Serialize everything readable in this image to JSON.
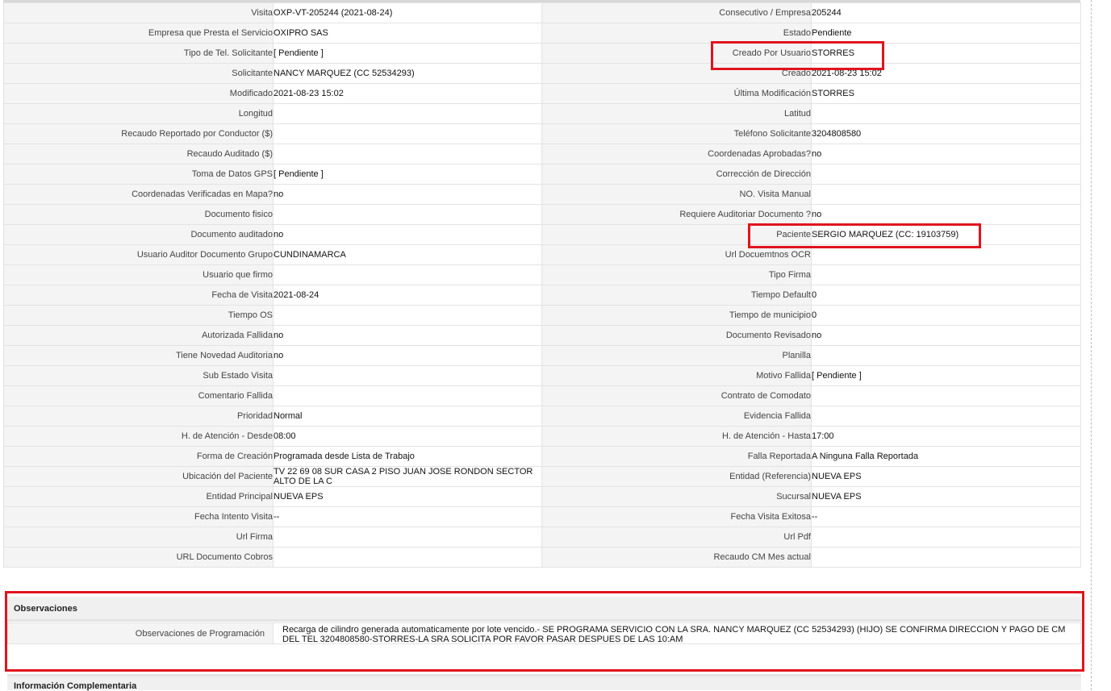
{
  "rows": [
    {
      "l1": "Visita",
      "v1": "OXP-VT-205244 (2021-08-24)",
      "l2": "Consecutivo / Empresa",
      "v2": "205244"
    },
    {
      "l1": "Empresa que Presta el Servicio",
      "v1": "OXIPRO SAS",
      "l2": "Estado",
      "v2": "Pendiente"
    },
    {
      "l1": "Tipo de Tel. Solicitante",
      "v1": "[ Pendiente ]",
      "l2": "Creado Por Usuario",
      "v2": "STORRES"
    },
    {
      "l1": "Solicitante",
      "v1": "NANCY MARQUEZ (CC 52534293)",
      "l2": "Creado",
      "v2": "2021-08-23 15:02"
    },
    {
      "l1": "Modificado",
      "v1": "2021-08-23 15:02",
      "l2": "Última Modificación",
      "v2": " STORRES"
    },
    {
      "l1": "Longitud",
      "v1": "",
      "l2": "Latitud",
      "v2": ""
    },
    {
      "l1": "Recaudo Reportado por Conductor ($)",
      "v1": "",
      "l2": "Teléfono Solicitante",
      "v2": "3204808580"
    },
    {
      "l1": "Recaudo Auditado ($)",
      "v1": "",
      "l2": "Coordenadas Aprobadas?",
      "v2": " no"
    },
    {
      "l1": "Toma de Datos GPS",
      "v1": "[ Pendiente ]",
      "l2": "Corrección de Dirección",
      "v2": ""
    },
    {
      "l1": "Coordenadas Verificadas en Mapa?",
      "v1": " no",
      "l2": "NO. Visita Manual",
      "v2": ""
    },
    {
      "l1": "Documento fisico",
      "v1": "",
      "l2": "Requiere Auditoriar Documento ?",
      "v2": " no"
    },
    {
      "l1": "Documento auditado",
      "v1": "no",
      "l2": "Paciente",
      "v2": "SERGIO MARQUEZ (CC: 19103759)"
    },
    {
      "l1": "Usuario Auditor Documento Grupo",
      "v1": "CUNDINAMARCA",
      "l2": "Url Docuemtnos OCR",
      "v2": ""
    },
    {
      "l1": "Usuario que firmo",
      "v1": "",
      "l2": "Tipo Firma",
      "v2": ""
    },
    {
      "l1": "Fecha de Visita",
      "v1": " 2021-08-24",
      "l2": "Tiempo Default",
      "v2": "0"
    },
    {
      "l1": "Tiempo OS",
      "v1": "",
      "l2": "Tiempo de municipio",
      "v2": "0"
    },
    {
      "l1": "Autorizada Fallida",
      "v1": "no",
      "l2": "Documento Revisado",
      "v2": " no"
    },
    {
      "l1": "Tiene Novedad Auditoria",
      "v1": "no",
      "l2": "Planilla",
      "v2": ""
    },
    {
      "l1": "Sub Estado Visita",
      "v1": "",
      "l2": "Motivo Fallida",
      "v2": "[ Pendiente ]"
    },
    {
      "l1": "Comentario Fallida",
      "v1": "",
      "l2": "Contrato de Comodato",
      "v2": ""
    },
    {
      "l1": "Prioridad",
      "v1": "Normal",
      "l2": "Evidencia Fallida",
      "v2": ""
    },
    {
      "l1": "H. de Atención - Desde",
      "v1": "08:00",
      "l2": "H. de Atención - Hasta",
      "v2": "17:00"
    },
    {
      "l1": "Forma de Creación",
      "v1": "Programada desde Lista de Trabajo",
      "l2": "Falla Reportada",
      "v2": "A Ninguna Falla Reportada"
    },
    {
      "l1": "Ubicación del Paciente",
      "v1": "TV 22 69 08 SUR CASA 2 PISO JUAN JOSE RONDON SECTOR ALTO DE LA C",
      "l2": "Entidad (Referencia)",
      "v2": "NUEVA EPS"
    },
    {
      "l1": "Entidad Principal",
      "v1": "NUEVA EPS",
      "l2": "Sucursal",
      "v2": "NUEVA EPS"
    },
    {
      "l1": "Fecha Intento Visita",
      "v1": " --",
      "l2": "Fecha Visita Exitosa",
      "v2": " --"
    },
    {
      "l1": "Url Firma",
      "v1": "",
      "l2": "Url Pdf",
      "v2": ""
    },
    {
      "l1": "URL Documento Cobros",
      "v1": "",
      "l2": "Recaudo CM Mes actual",
      "v2": ""
    }
  ],
  "observaciones": {
    "title": "Observaciones",
    "label": "Observaciones de Programación",
    "value": "  Recarga de cilindro generada automaticamente por lote vencido.- SE PROGRAMA SERVICIO CON LA SRA. NANCY MARQUEZ (CC 52534293) (HIJO) SE CONFIRMA DIRECCION Y PAGO DE CM DEL TEL 3204808580-STORRES-LA SRA SOLICITA POR FAVOR PASAR DESPUES DE LAS 10:AM"
  },
  "info_complementaria": {
    "title": "Información Complementaria"
  },
  "highlight_color": "#e0141e"
}
